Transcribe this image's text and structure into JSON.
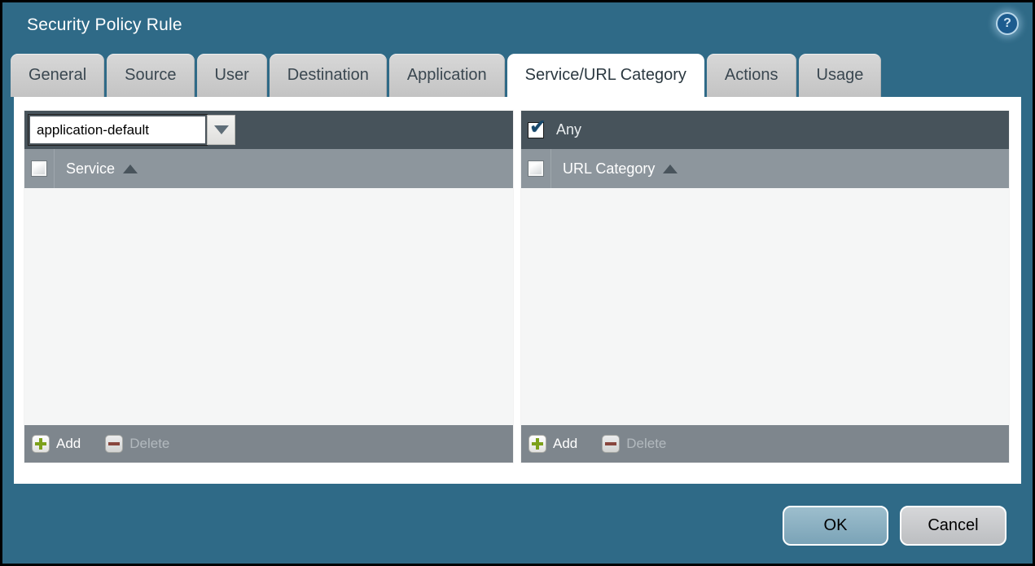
{
  "window": {
    "title": "Security Policy Rule",
    "help_glyph": "?"
  },
  "tabs": [
    {
      "label": "General",
      "active": false
    },
    {
      "label": "Source",
      "active": false
    },
    {
      "label": "User",
      "active": false
    },
    {
      "label": "Destination",
      "active": false
    },
    {
      "label": "Application",
      "active": false
    },
    {
      "label": "Service/URL Category",
      "active": true
    },
    {
      "label": "Actions",
      "active": false
    },
    {
      "label": "Usage",
      "active": false
    }
  ],
  "service_panel": {
    "dropdown_value": "application-default",
    "column_header": "Service",
    "sort_order": "ascending",
    "rows": [],
    "add_label": "Add",
    "delete_label": "Delete",
    "delete_enabled": false
  },
  "url_category_panel": {
    "any_label": "Any",
    "any_checked": true,
    "column_header": "URL Category",
    "sort_order": "ascending",
    "rows": [],
    "add_label": "Add",
    "delete_label": "Delete",
    "delete_enabled": false
  },
  "dialog_buttons": {
    "ok_label": "OK",
    "cancel_label": "Cancel"
  },
  "colors": {
    "background_teal": "#2f6a87",
    "toolbar_dark": "#47535b",
    "header_gray": "#8d969d",
    "footer_gray": "#7e868d",
    "body_light": "#f5f6f6",
    "tab_inactive": "#cccccc",
    "tab_active": "#ffffff",
    "add_green": "#7da11b",
    "delete_red": "#8a3c30",
    "check_blue": "#17486b",
    "ok_button_blue": "#85abbd",
    "cancel_button_gray": "#c6c8ca"
  }
}
